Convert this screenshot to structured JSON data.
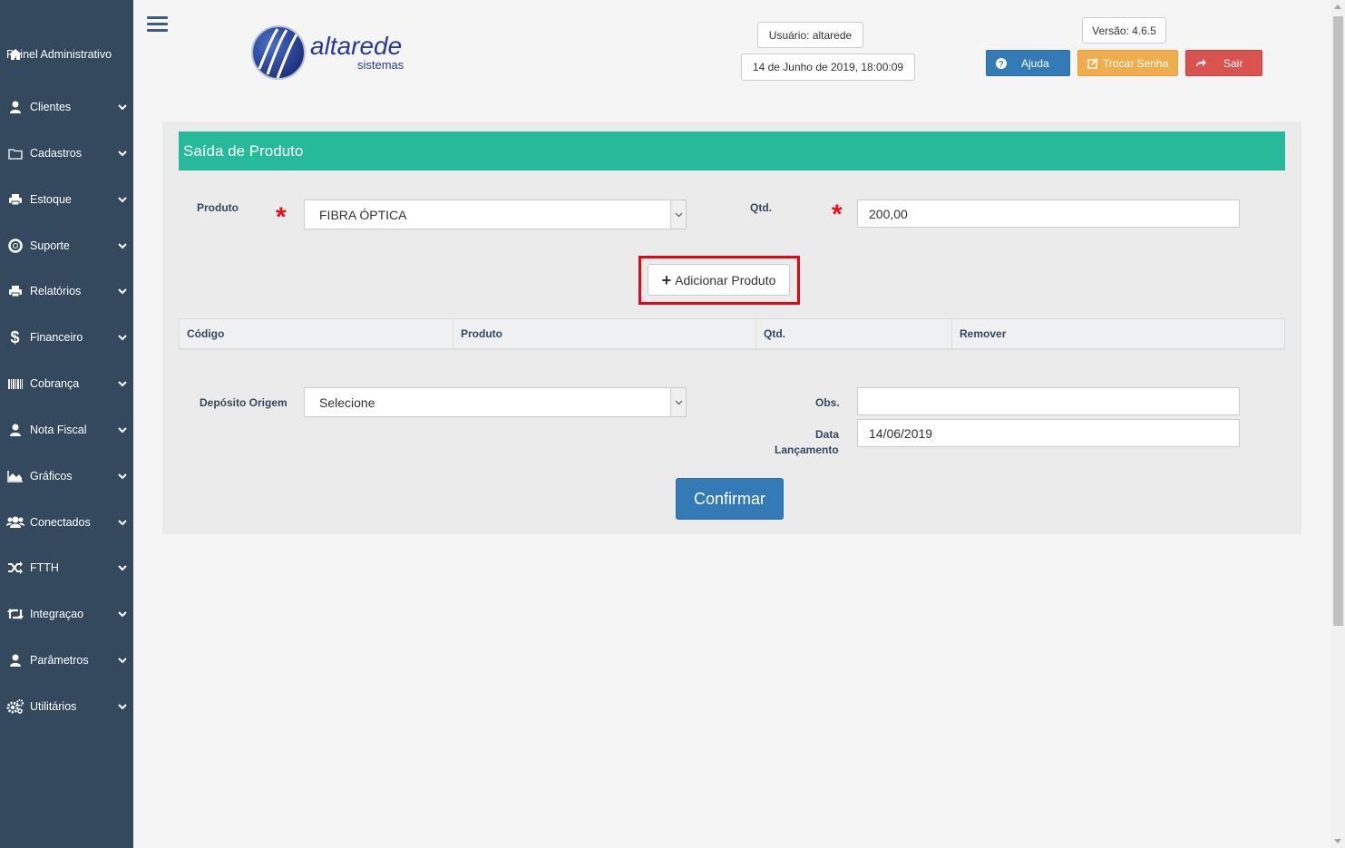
{
  "sidebar": {
    "items": [
      {
        "label": "Painel Administrativo",
        "icon": "home-icon"
      },
      {
        "label": "Clientes",
        "icon": "user-icon"
      },
      {
        "label": "Cadastros",
        "icon": "folder-icon"
      },
      {
        "label": "Estoque",
        "icon": "print-icon"
      },
      {
        "label": "Suporte",
        "icon": "lifebuoy-icon"
      },
      {
        "label": "Relatórios",
        "icon": "print-icon"
      },
      {
        "label": "Financeiro",
        "icon": "dollar-icon"
      },
      {
        "label": "Cobrança",
        "icon": "barcode-icon"
      },
      {
        "label": "Nota Fiscal",
        "icon": "user-icon"
      },
      {
        "label": "Gráficos",
        "icon": "area-chart-icon"
      },
      {
        "label": "Conectados",
        "icon": "users-icon"
      },
      {
        "label": "FTTH",
        "icon": "random-icon"
      },
      {
        "label": "Integraçao",
        "icon": "retweet-icon"
      },
      {
        "label": "Parâmetros",
        "icon": "user-icon"
      },
      {
        "label": "Utilitários",
        "icon": "gears-icon"
      }
    ]
  },
  "header": {
    "logo_main": "altarede",
    "logo_sub": "sistemas",
    "user": "Usuário: altarede",
    "datetime": "14 de Junho de 2019, 18:00:09",
    "version": "Versão: 4.6.5",
    "help_label": "Ajuda",
    "change_password_label": "Trocar Senha",
    "logout_label": "Sair"
  },
  "form": {
    "title": "Saída de Produto",
    "product_label": "Produto",
    "product_value": "FIBRA ÓPTICA",
    "qty_label": "Qtd.",
    "qty_value": "200,00",
    "add_product_label": "Adicionar Produto",
    "table_headers": [
      "Código",
      "Produto",
      "Qtd.",
      "Remover"
    ],
    "deposit_label": "Depósito Origem",
    "deposit_value": "Selecione",
    "obs_label": "Obs.",
    "obs_value": "",
    "date_label_line1": "Data",
    "date_label_line2": "Lançamento",
    "date_value": "14/06/2019",
    "confirm_label": "Confirmar"
  },
  "colors": {
    "sidebar_bg": "#34495e",
    "panel_title_bg": "#26b99a",
    "primary": "#337ab7",
    "warning": "#f0ad4e",
    "danger": "#d9534f",
    "required": "#e7101d",
    "highlight": "#e30613"
  }
}
